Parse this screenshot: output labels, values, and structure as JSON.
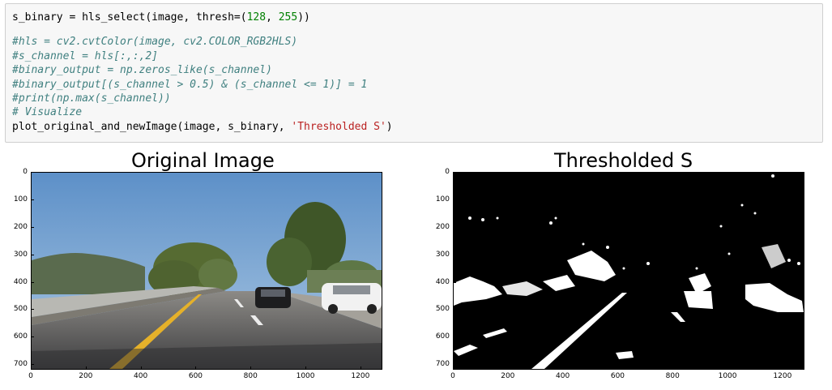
{
  "code_cell": {
    "lines": [
      {
        "segments": [
          {
            "text": "s_binary = hls_select(image, thresh=(",
            "cls": ""
          },
          {
            "text": "128",
            "cls": "num"
          },
          {
            "text": ", ",
            "cls": ""
          },
          {
            "text": "255",
            "cls": "num"
          },
          {
            "text": "))",
            "cls": ""
          }
        ]
      },
      {
        "segments": []
      },
      {
        "segments": [
          {
            "text": "#hls = cv2.cvtColor(image, cv2.COLOR_RGB2HLS)",
            "cls": "cmt"
          }
        ]
      },
      {
        "segments": [
          {
            "text": "#s_channel = hls[:,:,2]",
            "cls": "cmt"
          }
        ]
      },
      {
        "segments": [
          {
            "text": "#binary_output = np.zeros_like(s_channel)",
            "cls": "cmt"
          }
        ]
      },
      {
        "segments": [
          {
            "text": "#binary_output[(s_channel > 0.5) & (s_channel <= 1)] = 1",
            "cls": "cmt"
          }
        ]
      },
      {
        "segments": [
          {
            "text": "#print(np.max(s_channel))",
            "cls": "cmt"
          }
        ]
      },
      {
        "segments": [
          {
            "text": "# Visualize",
            "cls": "cmt"
          }
        ]
      },
      {
        "segments": [
          {
            "text": "plot_original_and_newImage(image, s_binary, ",
            "cls": ""
          },
          {
            "text": "'Thresholded S'",
            "cls": "str"
          },
          {
            "text": ")",
            "cls": ""
          }
        ]
      }
    ]
  },
  "figures": [
    {
      "title": "Original Image",
      "y_ticks": [
        "0",
        "100",
        "200",
        "300",
        "400",
        "500",
        "600",
        "700"
      ],
      "x_ticks": [
        "0",
        "200",
        "400",
        "600",
        "800",
        "1000",
        "1200"
      ]
    },
    {
      "title": "Thresholded S",
      "y_ticks": [
        "0",
        "100",
        "200",
        "300",
        "400",
        "500",
        "600",
        "700"
      ],
      "x_ticks": [
        "0",
        "200",
        "400",
        "600",
        "800",
        "1000",
        "1200"
      ]
    }
  ],
  "axes": {
    "x_range": [
      0,
      1280
    ],
    "y_range": [
      0,
      720
    ],
    "y_inverted": true
  },
  "colors": {
    "code_background": "#f7f7f7",
    "number": "#008000",
    "string": "#ba2121",
    "comment": "#408080"
  }
}
